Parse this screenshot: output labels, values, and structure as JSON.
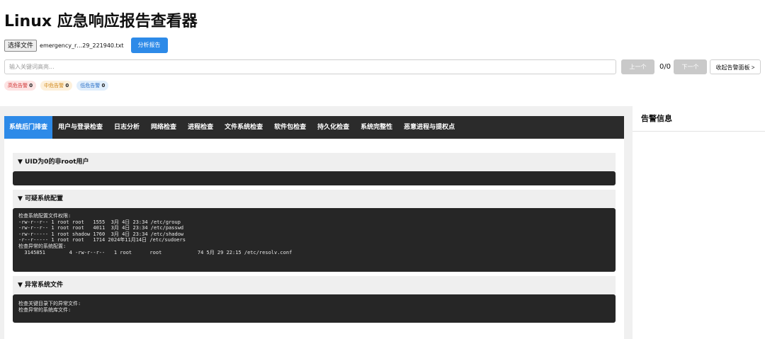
{
  "header": {
    "title": "Linux 应急响应报告查看器"
  },
  "file": {
    "choose_label": "选择文件",
    "file_name": "emergency_r…29_221940.txt",
    "analyze_label": "分析报告"
  },
  "search": {
    "placeholder": "输入关键词高亮...",
    "prev_label": "上一个",
    "counter": "0/0",
    "next_label": "下一个",
    "collapse_label": "收起告警面板 >"
  },
  "badges": {
    "high_label": "高危告警",
    "high_count": "0",
    "mid_label": "中危告警",
    "mid_count": "0",
    "low_label": "低危告警",
    "low_count": "0"
  },
  "tabs": [
    {
      "label": "系统后门排查"
    },
    {
      "label": "用户与登录检查"
    },
    {
      "label": "日志分析"
    },
    {
      "label": "网络检查"
    },
    {
      "label": "进程检查"
    },
    {
      "label": "文件系统检查"
    },
    {
      "label": "软件包检查"
    },
    {
      "label": "持久化检查"
    },
    {
      "label": "系统完整性"
    },
    {
      "label": "恶意进程与提权点"
    }
  ],
  "sections": [
    {
      "title": "▼ UID为0的非root用户",
      "content": ""
    },
    {
      "title": "▼ 可疑系统配置",
      "content": "检查系统配置文件权限:\n-rw-r--r-- 1 root root   1555  3月 4日 23:34 /etc/group\n-rw-r--r-- 1 root root   4011  3月 4日 23:34 /etc/passwd\n-rw-r----- 1 root shadow 1760  3月 4日 23:34 /etc/shadow\n-r--r----- 1 root root   1714 2024年11月14日 /etc/sudoers\n检查异常的系统配置:\n  3145851        4 -rw-r--r--   1 root      root            74 5月 29 22:15 /etc/resolv.conf"
    },
    {
      "title": "▼ 异常系统文件",
      "content": "检查关键目录下的异常文件:\n检查异常的系统库文件:"
    }
  ],
  "side": {
    "title": "告警信息"
  }
}
